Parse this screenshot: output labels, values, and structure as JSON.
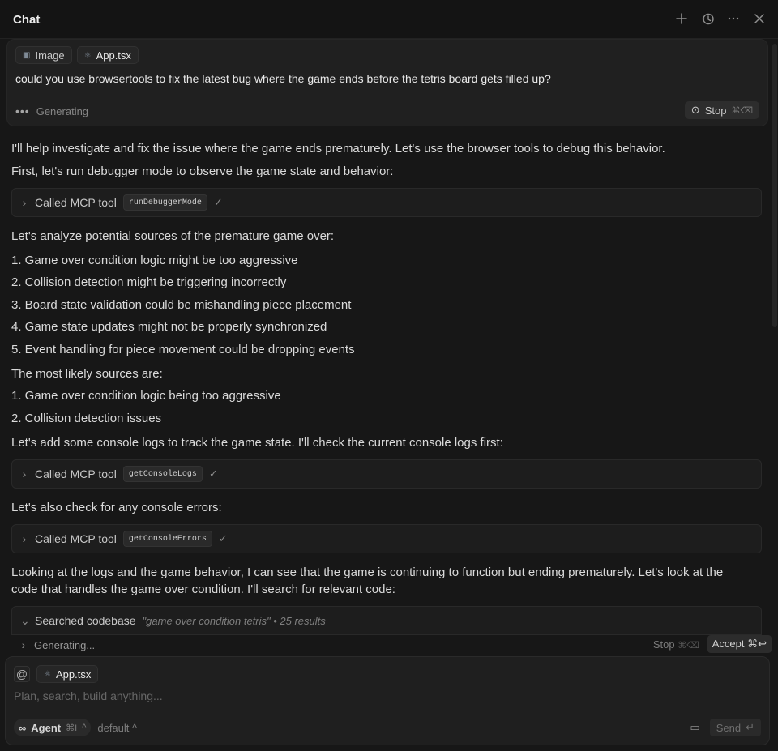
{
  "header": {
    "title": "Chat",
    "icons": [
      "plus-icon",
      "history-icon",
      "more-icon",
      "close-icon"
    ]
  },
  "prompt": {
    "chips": [
      {
        "label": "Image",
        "icon": "image-icon"
      },
      {
        "label": "App.tsx",
        "icon": "react-icon"
      }
    ],
    "text": "could you use browsertools to fix the latest bug where the game ends before the tetris board gets filled up?",
    "status": "Generating",
    "stop_label": "Stop",
    "stop_shortcut": "⌘⌫"
  },
  "messages": {
    "intro": "I'll help investigate and fix the issue where the game ends prematurely. Let's use the browser tools to debug this behavior.",
    "step1": "First, let's run debugger mode to observe the game state and behavior:",
    "tool1": {
      "label": "Called MCP tool",
      "name": "runDebuggerMode"
    },
    "analyze": "Let's analyze potential sources of the premature game over:",
    "list1": [
      "1. Game over condition logic might be too aggressive",
      "2. Collision detection might be triggering incorrectly",
      "3. Board state validation could be mishandling piece placement",
      "4. Game state updates might not be properly synchronized",
      "5. Event handling for piece movement could be dropping events"
    ],
    "likely": "The most likely sources are:",
    "list2": [
      "1. Game over condition logic being too aggressive",
      "2. Collision detection issues"
    ],
    "logs": "Let's add some console logs to track the game state. I'll check the current console logs first:",
    "tool2": {
      "label": "Called MCP tool",
      "name": "getConsoleLogs"
    },
    "errors": "Let's also check for any console errors:",
    "tool3": {
      "label": "Called MCP tool",
      "name": "getConsoleErrors"
    },
    "looking1": "Looking at the logs and the game behavior, I can see that the game is continuing to function but ending prematurely. Let's look at the",
    "looking2": "code that handles the game over condition. I'll search for relevant code:",
    "search": {
      "label": "Searched codebase",
      "query": "\"game over condition tetris\" • 25 results"
    },
    "generating": "Generating...",
    "stop_label": "Stop",
    "stop_shortcut": "⌘⌫",
    "accept_label": "Accept ⌘↩"
  },
  "composer": {
    "at": "@",
    "chip": "App.tsx",
    "placeholder": "Plan, search, build anything...",
    "agent_label": "Agent",
    "agent_shortcut": "⌘I",
    "model": "default",
    "send_label": "Send"
  }
}
